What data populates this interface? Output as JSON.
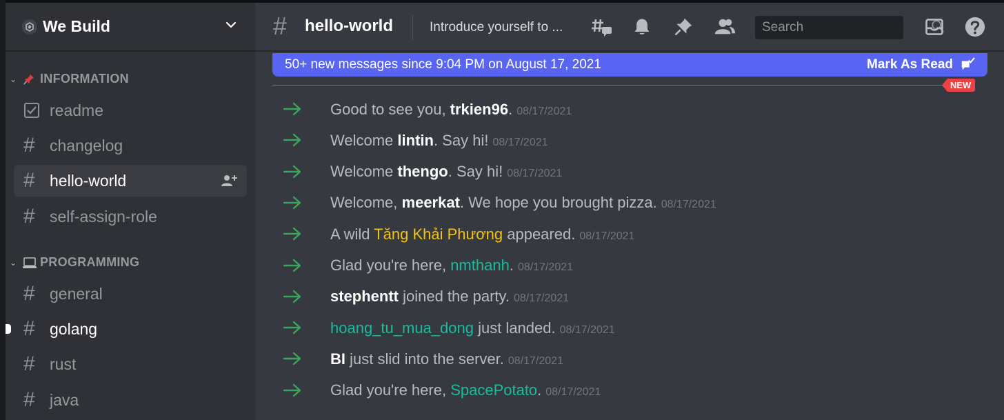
{
  "server": {
    "name": "We Build"
  },
  "categories": [
    {
      "name": "INFORMATION",
      "emoji": "pushpin"
    },
    {
      "name": "PROGRAMMING",
      "emoji": "laptop"
    }
  ],
  "channels": [
    {
      "label": "readme"
    },
    {
      "label": "changelog"
    },
    {
      "label": "hello-world"
    },
    {
      "label": "self-assign-role"
    },
    {
      "label": "general"
    },
    {
      "label": "golang"
    },
    {
      "label": "rust"
    },
    {
      "label": "java"
    }
  ],
  "header": {
    "channel": "hello-world",
    "topic": "Introduce yourself to ...",
    "search_placeholder": "Search"
  },
  "banner": {
    "text": "50+ new messages since 9:04 PM on August 17, 2021",
    "action": "Mark As Read"
  },
  "new_badge": "NEW",
  "messages": [
    {
      "pre": "Good to see you, ",
      "user": "trkien96",
      "post": ".",
      "ts": "08/17/2021"
    },
    {
      "pre": "Welcome ",
      "user": "lintin",
      "post": ". Say hi!",
      "ts": "08/17/2021"
    },
    {
      "pre": "Welcome ",
      "user": "thengo",
      "post": ". Say hi!",
      "ts": "08/17/2021"
    },
    {
      "pre": "Welcome, ",
      "user": "meerkat",
      "post": ". We hope you brought pizza.",
      "ts": "08/17/2021"
    },
    {
      "pre": "A wild ",
      "user": "Tăng Khải Phương",
      "post": " appeared.",
      "ts": "08/17/2021"
    },
    {
      "pre": "Glad you're here, ",
      "user": "nmthanh",
      "post": ".",
      "ts": "08/17/2021"
    },
    {
      "pre": "",
      "user": "stephentt",
      "post": " joined the party.",
      "ts": "08/17/2021"
    },
    {
      "pre": "",
      "user": "hoang_tu_mua_dong",
      "post": " just landed.",
      "ts": "08/17/2021"
    },
    {
      "pre": "",
      "user": "BI",
      "post": " just slid into the server.",
      "ts": "08/17/2021"
    },
    {
      "pre": "Glad you're here, ",
      "user": "SpacePotato",
      "post": ".",
      "ts": "08/17/2021"
    }
  ],
  "colors": {
    "accent": "#5865f2",
    "new_marker": "#ed4245",
    "join_arrow": "#3ba55c",
    "role_teal": "#1abc9c",
    "role_gold": "#f1c40f"
  },
  "icons": [
    "threads-icon",
    "bell-icon",
    "pin-icon",
    "members-icon",
    "search-icon",
    "inbox-icon",
    "help-icon",
    "join-arrow-icon",
    "add-member-icon",
    "checklist-icon",
    "mark-read-icon"
  ]
}
